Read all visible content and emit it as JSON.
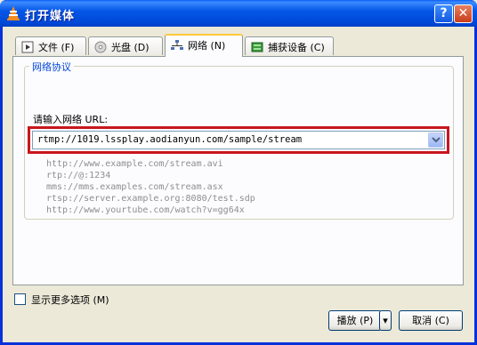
{
  "window": {
    "title": "打开媒体",
    "help_label": "?",
    "close_label": "✕"
  },
  "tabs": [
    {
      "label": "文件 (F)",
      "icon": "file-icon",
      "active": false
    },
    {
      "label": "光盘 (D)",
      "icon": "disc-icon",
      "active": false
    },
    {
      "label": "网络 (N)",
      "icon": "network-icon",
      "active": true
    },
    {
      "label": "捕获设备 (C)",
      "icon": "capture-device-icon",
      "active": false
    }
  ],
  "network": {
    "group_title": "网络协议",
    "url_label": "请输入网络 URL:",
    "url_value": "rtmp://1019.lssplay.aodianyun.com/sample/stream",
    "examples": [
      "http://www.example.com/stream.avi",
      "rtp://@:1234",
      "mms://mms.examples.com/stream.asx",
      "rtsp://server.example.org:8080/test.sdp",
      "http://www.yourtube.com/watch?v=gg64x"
    ]
  },
  "options": {
    "show_more_label": "显示更多选项 (M)",
    "show_more_checked": false
  },
  "buttons": {
    "play_label": "播放 (P)",
    "play_dropdown_label": "▾",
    "cancel_label": "取消 (C)"
  },
  "colors": {
    "title_bar": "#0054e3",
    "highlight_border": "#c8161d",
    "group_title": "#0046d5",
    "example_text": "#8e8e8e"
  }
}
